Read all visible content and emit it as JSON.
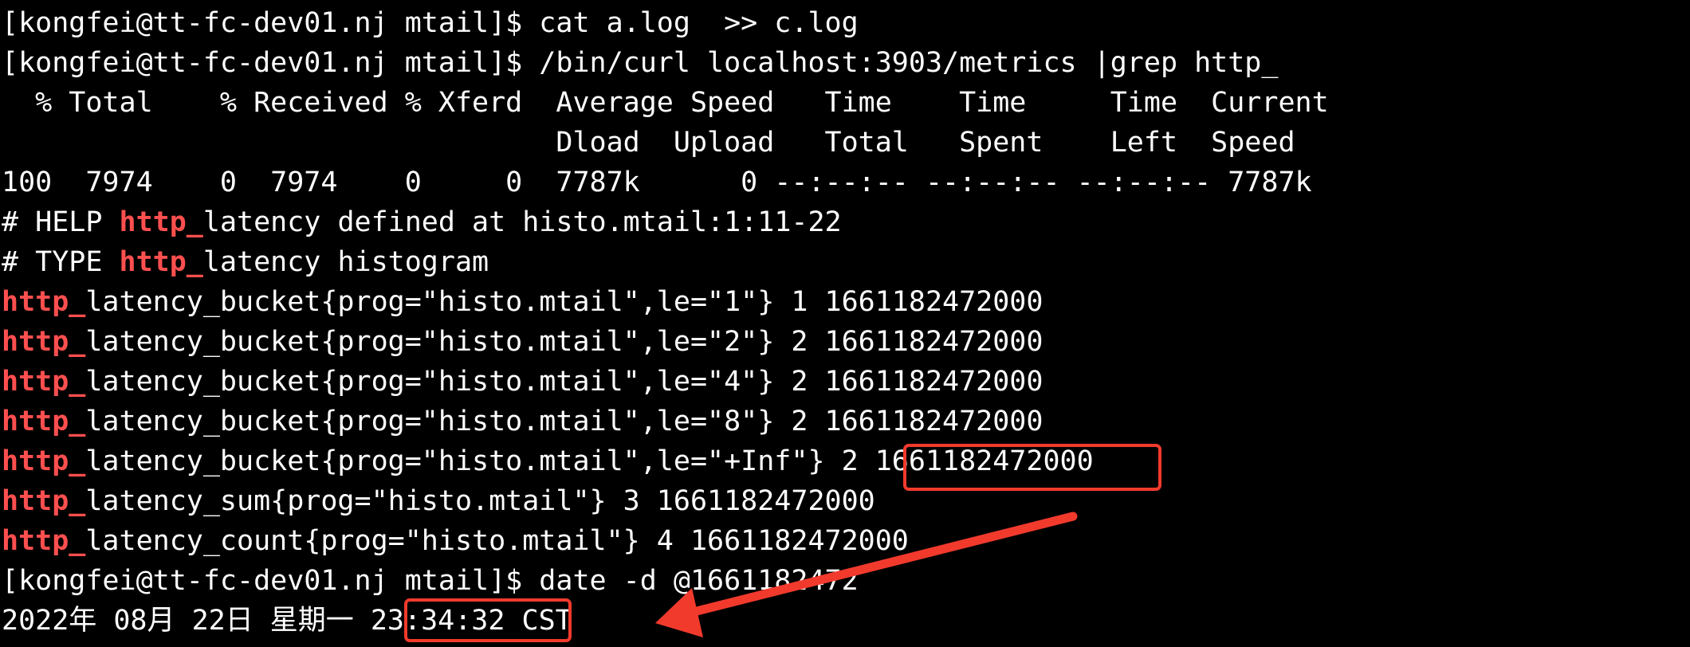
{
  "terminal": {
    "lines": [
      {
        "kind": "text",
        "text": "[kongfei@tt-fc-dev01.nj mtail]$ cat a.log  >> c.log"
      },
      {
        "kind": "text",
        "text": "[kongfei@tt-fc-dev01.nj mtail]$ /bin/curl localhost:3903/metrics |grep http_"
      },
      {
        "kind": "text",
        "text": "  % Total    % Received % Xferd  Average Speed   Time    Time     Time  Current"
      },
      {
        "kind": "text",
        "text": "                                 Dload  Upload   Total   Spent    Left  Speed"
      },
      {
        "kind": "text",
        "text": "100  7974    0  7974    0     0  7787k      0 --:--:-- --:--:-- --:--:-- 7787k"
      },
      {
        "kind": "hl",
        "pre": "# HELP ",
        "hl": "http_",
        "post": "latency defined at histo.mtail:1:11-22"
      },
      {
        "kind": "hl",
        "pre": "# TYPE ",
        "hl": "http_",
        "post": "latency histogram"
      },
      {
        "kind": "hl",
        "pre": "",
        "hl": "http_",
        "post": "latency_bucket{prog=\"histo.mtail\",le=\"1\"} 1 1661182472000"
      },
      {
        "kind": "hl",
        "pre": "",
        "hl": "http_",
        "post": "latency_bucket{prog=\"histo.mtail\",le=\"2\"} 2 1661182472000"
      },
      {
        "kind": "hl",
        "pre": "",
        "hl": "http_",
        "post": "latency_bucket{prog=\"histo.mtail\",le=\"4\"} 2 1661182472000"
      },
      {
        "kind": "hl",
        "pre": "",
        "hl": "http_",
        "post": "latency_bucket{prog=\"histo.mtail\",le=\"8\"} 2 1661182472000"
      },
      {
        "kind": "hl",
        "pre": "",
        "hl": "http_",
        "post": "latency_bucket{prog=\"histo.mtail\",le=\"+Inf\"} 2 1661182472000"
      },
      {
        "kind": "hl",
        "pre": "",
        "hl": "http_",
        "post": "latency_sum{prog=\"histo.mtail\"} 3 1661182472000"
      },
      {
        "kind": "hl",
        "pre": "",
        "hl": "http_",
        "post": "latency_count{prog=\"histo.mtail\"} 4 1661182472000"
      },
      {
        "kind": "text",
        "text": "[kongfei@tt-fc-dev01.nj mtail]$ date -d @1661182472"
      },
      {
        "kind": "text",
        "text": "2022年 08月 22日 星期一 23:34:32 CST"
      }
    ]
  },
  "colors": {
    "background": "#000000",
    "foreground": "#ffffff",
    "grep_match": "#ff4f4f",
    "annotation": "#f23a2c"
  },
  "annotations": {
    "highlight_boxes": [
      "timestamp-value-box",
      "time-value-box"
    ],
    "arrow_icon": "arrow-icon"
  }
}
